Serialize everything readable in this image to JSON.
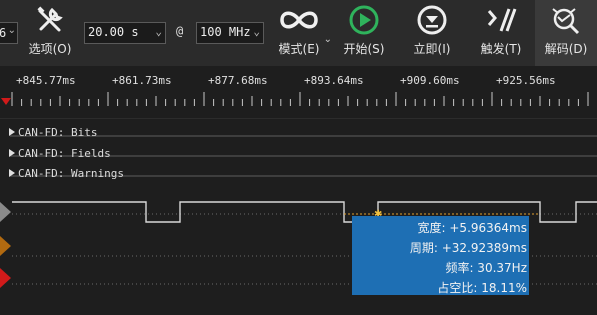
{
  "toolbar": {
    "partial_left": "6",
    "options_label": "选项(O)",
    "timebase": "20.00 s",
    "at": "@",
    "sample_rate": "100 MHz",
    "mode_label": "模式(E)",
    "start_label": "开始(S)",
    "immediate_label": "立即(I)",
    "trigger_label": "触发(T)",
    "decode_label": "解码(D)",
    "colors": {
      "start_green": "#2fb35c",
      "panel": "#2b2b2b"
    }
  },
  "ruler": {
    "ticks": [
      "+845.77ms",
      "+861.73ms",
      "+877.68ms",
      "+893.64ms",
      "+909.60ms",
      "+925.56ms"
    ]
  },
  "channels": {
    "bits": "CAN-FD: Bits",
    "fields": "CAN-FD: Fields",
    "warnings": "CAN-FD: Warnings"
  },
  "measurement": {
    "width": "宽度: +5.96364ms",
    "period": "周期: +32.92389ms",
    "frequency": "频率: 30.37Hz",
    "duty": "占空比: 18.11%"
  }
}
